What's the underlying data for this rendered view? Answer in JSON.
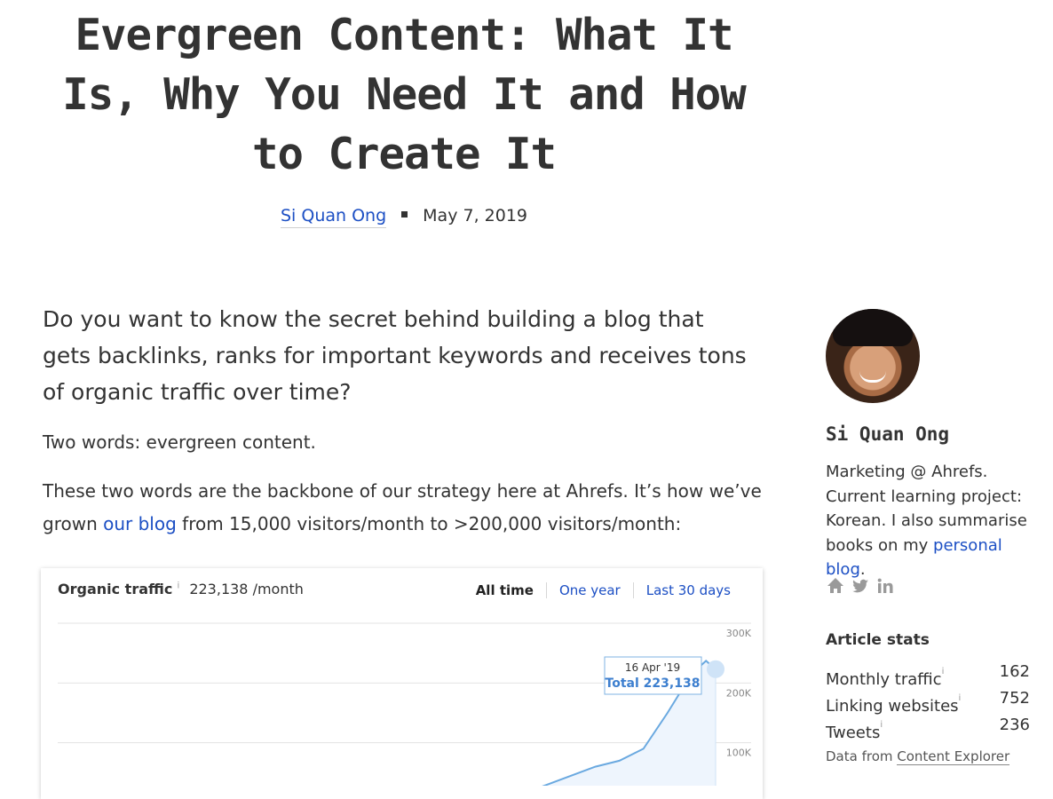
{
  "article": {
    "title": "Evergreen Content: What It Is, Why You Need It and How to Create It",
    "author": "Si Quan Ong",
    "date": "May 7, 2019",
    "lead": "Do you want to know the secret behind building a blog that gets backlinks, ranks for important keywords and receives tons of organic traffic over time?",
    "p1": "Two words: evergreen content.",
    "p2_before": "These two words are the backbone of our strategy here at Ahrefs. It’s how we’ve grown ",
    "p2_link": "our blog",
    "p2_after": " from 15,000 visitors/month to >200,000 visitors/month:"
  },
  "chart_card": {
    "label": "Organic traffic",
    "info": "i",
    "value": "223,138 /month",
    "tabs": [
      "All time",
      "One year",
      "Last 30 days"
    ],
    "active_tab": "All time",
    "tooltip_date": "16 Apr '19",
    "tooltip_total": "Total 223,138",
    "colors": {
      "line": "#6aa9e0",
      "fill": "#eef5fd",
      "tab_link": "#1c4fc4"
    }
  },
  "chart_data": {
    "type": "area",
    "title": "Organic traffic",
    "y_ticks": [
      "300K",
      "200K",
      "100K"
    ],
    "ylim": [
      0,
      300000
    ],
    "x": [
      0,
      10,
      20,
      30,
      40,
      50,
      60,
      70,
      80,
      90,
      96,
      100
    ],
    "y": [
      0,
      5000,
      15000,
      30000,
      45000,
      60000,
      70000,
      90000,
      150000,
      215000,
      237000,
      223138
    ]
  },
  "sidebar": {
    "author_name": "Si Quan Ong",
    "bio_text": "Marketing @ Ahrefs. Current learning project: Korean. I also summarise books on my ",
    "bio_link": "personal blog",
    "bio_end": ".",
    "social_icons": [
      "home-icon",
      "twitter-icon",
      "linkedin-icon"
    ],
    "stats_title": "Article stats",
    "stats": [
      {
        "label": "Monthly traffic",
        "value": "162"
      },
      {
        "label": "Linking websites",
        "value": "752"
      },
      {
        "label": "Tweets",
        "value": "236"
      }
    ],
    "source_prefix": "Data from ",
    "source_link": "Content Explorer"
  }
}
